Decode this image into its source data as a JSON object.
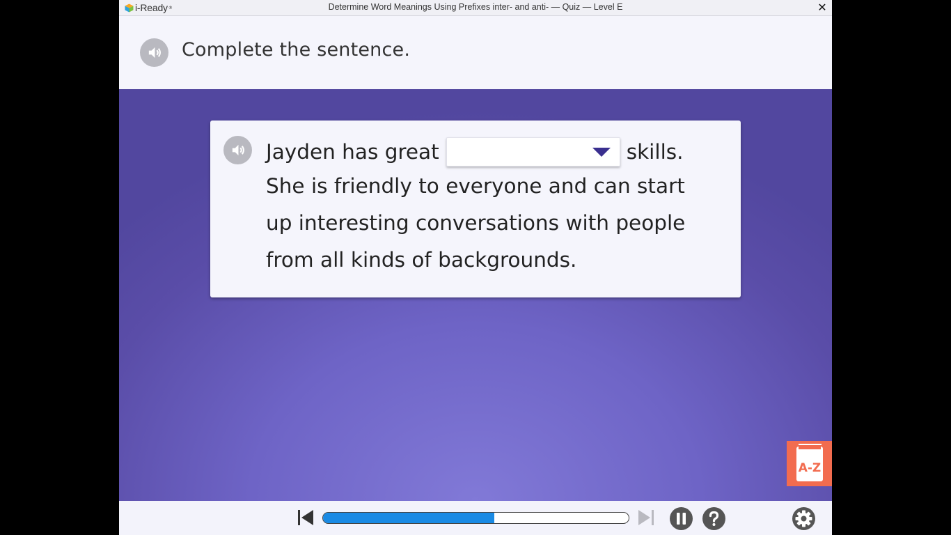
{
  "window": {
    "logo_text": "i-Ready",
    "logo_mark": "®",
    "title": "Determine Word Meanings Using Prefixes inter- and anti- — Quiz — Level E",
    "close_symbol": "✕"
  },
  "instruction": {
    "text": "Complete the sentence.",
    "speaker_icon": "speaker-icon"
  },
  "question": {
    "speaker_icon": "speaker-icon",
    "before_blank": "Jayden has great",
    "dropdown_value": "",
    "after_blank": "skills.",
    "lines": [
      "She is friendly to everyone and can start",
      "up interesting conversations with people",
      "from all kinds of backgrounds."
    ]
  },
  "glossary": {
    "label": "A-Z",
    "icon": "book-icon"
  },
  "controls": {
    "back_icon": "skip-back-icon",
    "forward_icon": "skip-forward-icon",
    "pause_icon": "pause-icon",
    "help_icon": "help-icon",
    "settings_icon": "gear-icon",
    "progress_percent": 56
  },
  "colors": {
    "accent": "#1a8ae4",
    "stage": "#5a4da8",
    "dropdown_arrow": "#3a2f8f",
    "glossary": "#f26c4f"
  }
}
